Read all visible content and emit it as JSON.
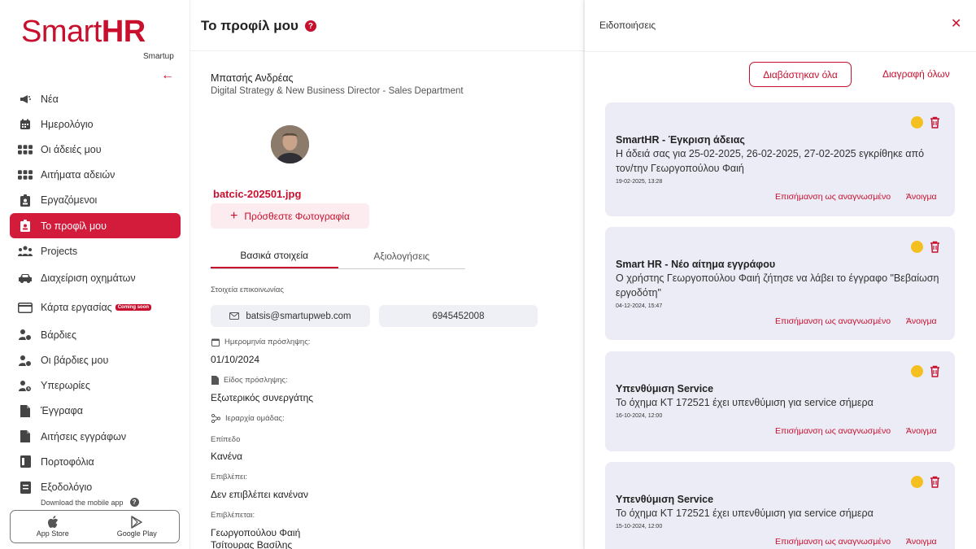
{
  "app": {
    "logo_prefix": "Smart",
    "logo_suffix": "HR",
    "logo_sub": "Smartup"
  },
  "sidebar": {
    "items": [
      {
        "label": "Νέα",
        "icon": "megaphone-icon"
      },
      {
        "label": "Ημερολόγιο",
        "icon": "calendar-icon"
      },
      {
        "label": "Οι άδειές μου",
        "icon": "grid-icon"
      },
      {
        "label": "Αιτήματα αδειών",
        "icon": "grid-icon"
      },
      {
        "label": "Εργαζόμενοι",
        "icon": "badge-icon"
      },
      {
        "label": "Το προφίλ μου",
        "icon": "badge-icon",
        "active": true
      },
      {
        "label": "Projects",
        "icon": "people-icon"
      },
      {
        "label": "Διαχείριση οχημάτων",
        "icon": "car-icon"
      },
      {
        "label": "Κάρτα εργασίας",
        "icon": "card-icon",
        "badge": "Coming soon"
      },
      {
        "label": "Βάρδιες",
        "icon": "shift-icon"
      },
      {
        "label": "Οι βάρδιες μου",
        "icon": "shift-icon"
      },
      {
        "label": "Υπερωρίες",
        "icon": "clock-icon"
      },
      {
        "label": "Έγγραφα",
        "icon": "document-icon"
      },
      {
        "label": "Αιτήσεις εγγράφων",
        "icon": "document-icon"
      },
      {
        "label": "Πορτοφόλια",
        "icon": "wallet-icon"
      },
      {
        "label": "Εξοδολόγιο",
        "icon": "receipt-icon"
      }
    ],
    "download_text": "Download the mobile app",
    "app_store": "App Store",
    "google_play": "Google Play"
  },
  "main": {
    "title": "Το προφίλ μου",
    "user_name": "Μπατσής Ανδρέας",
    "user_role": "Digital Strategy & New Business Director - Sales Department",
    "photo_filename": "batcic-202501.jpg",
    "add_photo_label": "Πρόσθεστε Φωτογραφία",
    "tabs": [
      "Βασικά στοιχεία",
      "Αξιολογήσεις"
    ],
    "contact_label": "Στοιχεία επικοινωνίας",
    "email": "batsis@smartupweb.com",
    "phone": "6945452008",
    "hire_date_label": "Ημερομηνία πρόσληψης:",
    "hire_date": "01/10/2024",
    "hire_type_label": "Είδος πρόσληψης:",
    "hire_type": "Εξωτερικός συνεργάτης",
    "hierarchy_label": "Ιεραρχία ομάδας:",
    "level_label": "Επίπεδο",
    "level": "Κανένα",
    "supervises_label": "Επιβλέπει:",
    "supervises": "Δεν επιβλέπει κανέναν",
    "supervised_by_label": "Επιβλέπεται:",
    "supervised_by": [
      "Γεωργοπούλου Φαιή",
      "Τσίτουρας Βασίλης"
    ]
  },
  "notifications": {
    "title": "Ειδοποιήσεις",
    "mark_all_read": "Διαβάστηκαν όλα",
    "delete_all": "Διαγραφή όλων",
    "mark_read_label": "Επισήμανση ως αναγνωσμένο",
    "open_label": "Άνοιγμα",
    "items": [
      {
        "title": "SmartHR - Έγκριση άδειας",
        "body": "Η άδειά σας για 25-02-2025, 26-02-2025, 27-02-2025 εγκρίθηκε από τον/την Γεωργοπούλου Φαιή",
        "date": "19-02-2025, 13:28"
      },
      {
        "title": "Smart HR - Νέο αίτημα εγγράφου",
        "body": "Ο χρήστης Γεωργοπούλου Φαιή ζήτησε να λάβει το έγγραφο \"Βεβαίωση εργοδότη\"",
        "date": "04-12-2024, 15:47"
      },
      {
        "title": "Υπενθύμιση Service",
        "body": "Το όχημα ΚΤ 172521 έχει υπενθύμιση για service σήμερα",
        "date": "16-10-2024, 12:00"
      },
      {
        "title": "Υπενθύμιση Service",
        "body": "Το όχημα ΚΤ 172521 έχει υπενθύμιση για service σήμερα",
        "date": "15-10-2024, 12:00"
      }
    ]
  },
  "colors": {
    "accent": "#c8102e",
    "card_bg": "#ececf6",
    "unread_dot": "#f4c020"
  }
}
